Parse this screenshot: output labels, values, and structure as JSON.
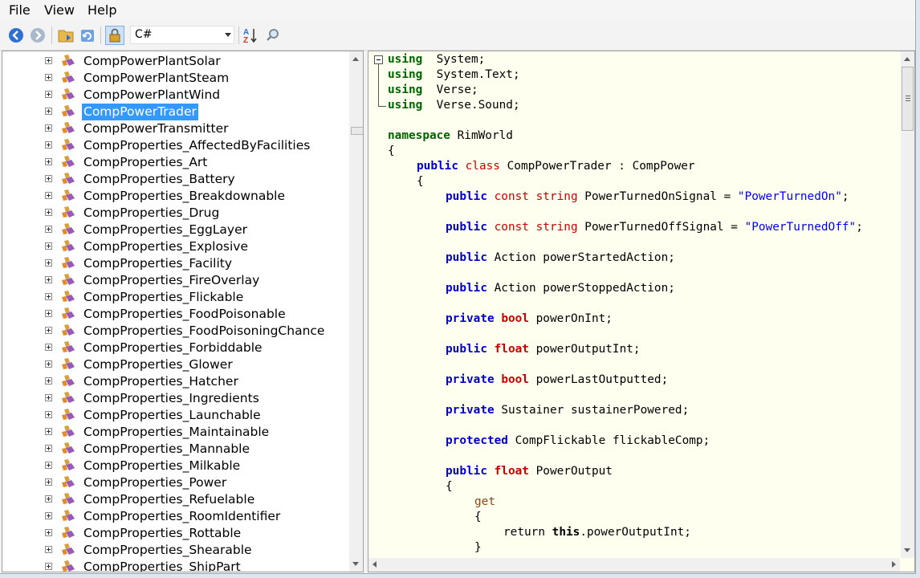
{
  "menu": [
    "File",
    "View",
    "Help"
  ],
  "toolbar": {
    "language": "C#",
    "buttons": [
      {
        "name": "back-icon",
        "label": "Back"
      },
      {
        "name": "forward-icon",
        "label": "Forward"
      },
      {
        "name": "open-folder-icon",
        "label": "Open"
      },
      {
        "name": "refresh-icon",
        "label": "Reload"
      },
      {
        "name": "lock-icon",
        "label": "Show private members"
      },
      {
        "name": "sort-az-icon",
        "label": "Sort"
      },
      {
        "name": "search-icon",
        "label": "Search"
      }
    ]
  },
  "tree": {
    "selected_index": 3,
    "items": [
      "CompPowerPlantSolar",
      "CompPowerPlantSteam",
      "CompPowerPlantWind",
      "CompPowerTrader",
      "CompPowerTransmitter",
      "CompProperties_AffectedByFacilities",
      "CompProperties_Art",
      "CompProperties_Battery",
      "CompProperties_Breakdownable",
      "CompProperties_Drug",
      "CompProperties_EggLayer",
      "CompProperties_Explosive",
      "CompProperties_Facility",
      "CompProperties_FireOverlay",
      "CompProperties_Flickable",
      "CompProperties_FoodPoisonable",
      "CompProperties_FoodPoisoningChance",
      "CompProperties_Forbiddable",
      "CompProperties_Glower",
      "CompProperties_Hatcher",
      "CompProperties_Ingredients",
      "CompProperties_Launchable",
      "CompProperties_Maintainable",
      "CompProperties_Mannable",
      "CompProperties_Milkable",
      "CompProperties_Power",
      "CompProperties_Refuelable",
      "CompProperties_RoomIdentifier",
      "CompProperties_Rottable",
      "CompProperties_Shearable",
      "CompProperties_ShipPart"
    ]
  },
  "code": {
    "lines": [
      {
        "indent": 0,
        "tokens": [
          [
            "kw-green",
            "using"
          ],
          [
            "",
            "  System;"
          ]
        ]
      },
      {
        "indent": 0,
        "tokens": [
          [
            "kw-green",
            "using"
          ],
          [
            "",
            "  System.Text;"
          ]
        ]
      },
      {
        "indent": 0,
        "tokens": [
          [
            "kw-green",
            "using"
          ],
          [
            "",
            "  Verse;"
          ]
        ]
      },
      {
        "indent": 0,
        "tokens": [
          [
            "kw-green",
            "using"
          ],
          [
            "",
            "  Verse.Sound;"
          ]
        ]
      },
      {
        "indent": 0,
        "tokens": []
      },
      {
        "indent": 0,
        "tokens": [
          [
            "kw-green",
            "namespace"
          ],
          [
            "",
            " RimWorld"
          ]
        ]
      },
      {
        "indent": 0,
        "tokens": [
          [
            "",
            "{"
          ]
        ]
      },
      {
        "indent": 1,
        "tokens": [
          [
            "kw-blue",
            "public"
          ],
          [
            "kw-red",
            " class"
          ],
          [
            "",
            " CompPowerTrader : CompPower"
          ]
        ]
      },
      {
        "indent": 1,
        "tokens": [
          [
            "",
            "{"
          ]
        ]
      },
      {
        "indent": 2,
        "tokens": [
          [
            "kw-blue",
            "public"
          ],
          [
            "kw-red",
            " const"
          ],
          [
            "kw-red",
            " string"
          ],
          [
            "",
            " PowerTurnedOnSignal = "
          ],
          [
            "str",
            "\"PowerTurnedOn\""
          ],
          [
            "",
            ";"
          ]
        ]
      },
      {
        "indent": 0,
        "tokens": []
      },
      {
        "indent": 2,
        "tokens": [
          [
            "kw-blue",
            "public"
          ],
          [
            "kw-red",
            " const"
          ],
          [
            "kw-red",
            " string"
          ],
          [
            "",
            " PowerTurnedOffSignal = "
          ],
          [
            "str",
            "\"PowerTurnedOff\""
          ],
          [
            "",
            ";"
          ]
        ]
      },
      {
        "indent": 0,
        "tokens": []
      },
      {
        "indent": 2,
        "tokens": [
          [
            "kw-blue",
            "public"
          ],
          [
            "",
            " Action powerStartedAction;"
          ]
        ]
      },
      {
        "indent": 0,
        "tokens": []
      },
      {
        "indent": 2,
        "tokens": [
          [
            "kw-blue",
            "public"
          ],
          [
            "",
            " Action powerStoppedAction;"
          ]
        ]
      },
      {
        "indent": 0,
        "tokens": []
      },
      {
        "indent": 2,
        "tokens": [
          [
            "kw-blue",
            "private"
          ],
          [
            "kw-red-b",
            " bool"
          ],
          [
            "",
            " powerOnInt;"
          ]
        ]
      },
      {
        "indent": 0,
        "tokens": []
      },
      {
        "indent": 2,
        "tokens": [
          [
            "kw-blue",
            "public"
          ],
          [
            "kw-red-b",
            " float"
          ],
          [
            "",
            " powerOutputInt;"
          ]
        ]
      },
      {
        "indent": 0,
        "tokens": []
      },
      {
        "indent": 2,
        "tokens": [
          [
            "kw-blue",
            "private"
          ],
          [
            "kw-red-b",
            " bool"
          ],
          [
            "",
            " powerLastOutputted;"
          ]
        ]
      },
      {
        "indent": 0,
        "tokens": []
      },
      {
        "indent": 2,
        "tokens": [
          [
            "kw-blue",
            "private"
          ],
          [
            "",
            " Sustainer sustainerPowered;"
          ]
        ]
      },
      {
        "indent": 0,
        "tokens": []
      },
      {
        "indent": 2,
        "tokens": [
          [
            "kw-blue",
            "protected"
          ],
          [
            "",
            " CompFlickable flickableComp;"
          ]
        ]
      },
      {
        "indent": 0,
        "tokens": []
      },
      {
        "indent": 2,
        "tokens": [
          [
            "kw-blue",
            "public"
          ],
          [
            "kw-red-b",
            " float"
          ],
          [
            "",
            " PowerOutput"
          ]
        ]
      },
      {
        "indent": 2,
        "tokens": [
          [
            "",
            "{"
          ]
        ]
      },
      {
        "indent": 3,
        "tokens": [
          [
            "kw-brown",
            "get"
          ]
        ]
      },
      {
        "indent": 3,
        "tokens": [
          [
            "",
            "{"
          ]
        ]
      },
      {
        "indent": 4,
        "tokens": [
          [
            "",
            "return "
          ],
          [
            "kw-black-b",
            "this"
          ],
          [
            "",
            ".powerOutputInt;"
          ]
        ]
      },
      {
        "indent": 3,
        "tokens": [
          [
            "",
            "}"
          ]
        ]
      }
    ]
  }
}
